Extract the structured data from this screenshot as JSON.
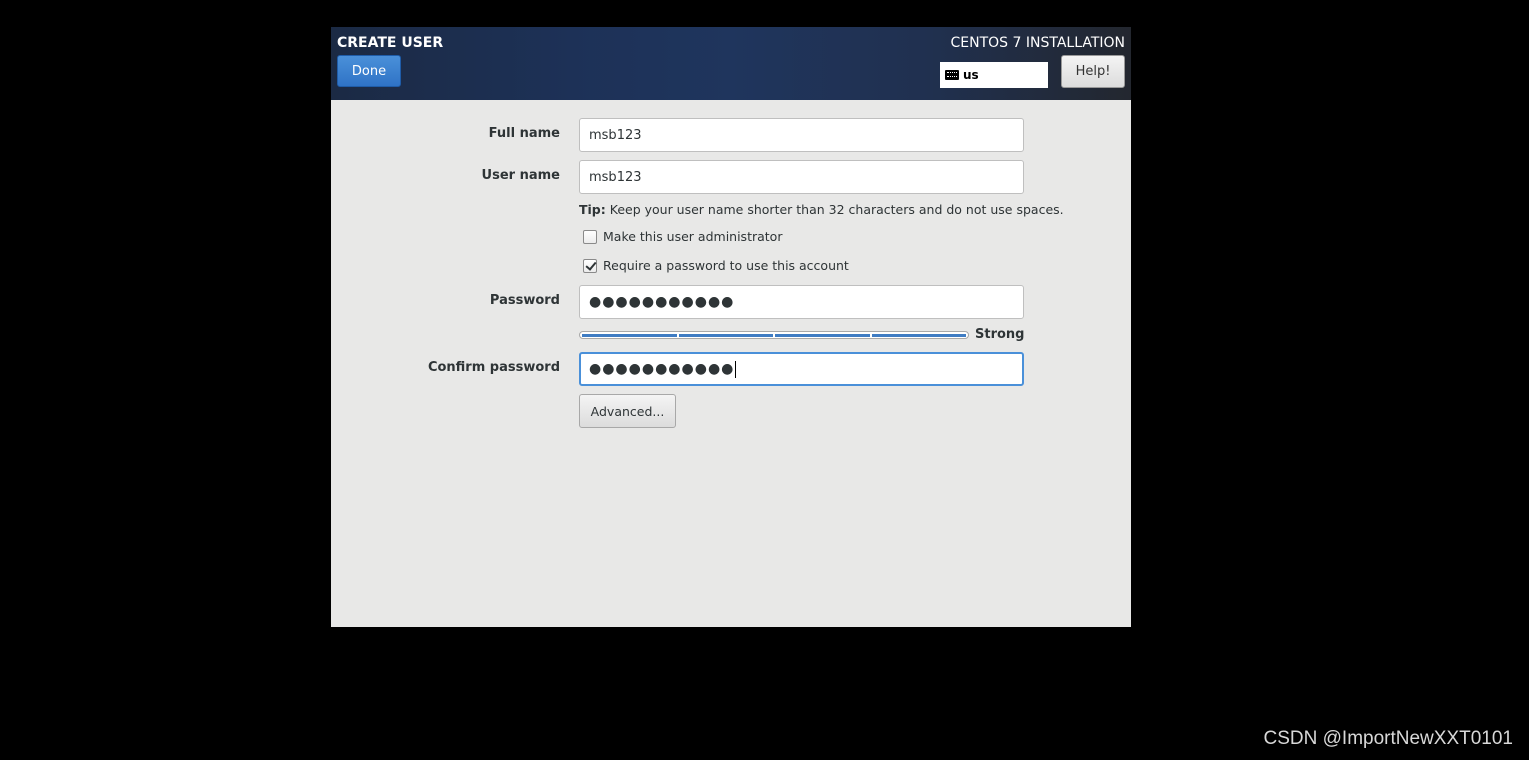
{
  "header": {
    "title": "CREATE USER",
    "done_label": "Done",
    "product": "CENTOS 7 INSTALLATION",
    "keyboard_layout": "us",
    "keyboard_icon": "keyboard-icon",
    "help_label": "Help!"
  },
  "form": {
    "full_name": {
      "label": "Full name",
      "value": "msb123"
    },
    "user_name": {
      "label": "User name",
      "value": "msb123"
    },
    "tip_bold": "Tip:",
    "tip_text": " Keep your user name shorter than 32 characters and do not use spaces.",
    "admin_checkbox": {
      "label": "Make this user administrator",
      "checked": false
    },
    "require_password_checkbox": {
      "label": "Require a password to use this account",
      "checked": true
    },
    "password": {
      "label": "Password",
      "masked": "●●●●●●●●●●●"
    },
    "strength": {
      "label": "Strong",
      "level": 4,
      "max": 4
    },
    "confirm_password": {
      "label": "Confirm password",
      "masked": "●●●●●●●●●●●"
    },
    "advanced_label": "Advanced..."
  },
  "colors": {
    "accent": "#4a90d9",
    "meter": "#3f7cc3"
  },
  "watermark": "CSDN @ImportNewXXT0101"
}
